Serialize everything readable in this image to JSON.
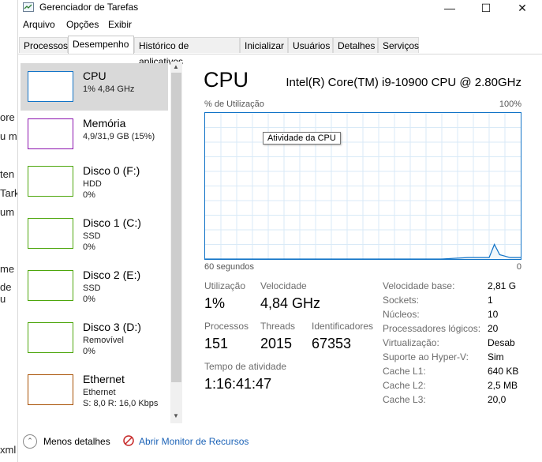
{
  "window": {
    "title": "Gerenciador de Tarefas",
    "minimize_icon": "minimize-icon",
    "maximize_icon": "maximize-icon",
    "close_icon": "close-icon"
  },
  "background_fragments": [
    "ore",
    "u m",
    "ten",
    "Tark",
    "um",
    "me",
    "de u",
    "xml"
  ],
  "menu": [
    "Arquivo",
    "Opções",
    "Exibir"
  ],
  "tabs": [
    "Processos",
    "Desempenho",
    "Histórico de aplicativos",
    "Inicializar",
    "Usuários",
    "Detalhes",
    "Serviços"
  ],
  "active_tab": "Desempenho",
  "resources": [
    {
      "name": "CPU",
      "sub1": "1% 4,84 GHz",
      "sub2": "",
      "color": "#1173c7",
      "selected": true
    },
    {
      "name": "Memória",
      "sub1": "4,9/31,9 GB (15%)",
      "sub2": "",
      "color": "#8b12ae",
      "selected": false
    },
    {
      "name": "Disco 0 (F:)",
      "sub1": "HDD",
      "sub2": "0%",
      "color": "#4da60c",
      "selected": false
    },
    {
      "name": "Disco 1 (C:)",
      "sub1": "SSD",
      "sub2": "0%",
      "color": "#4da60c",
      "selected": false
    },
    {
      "name": "Disco 2 (E:)",
      "sub1": "SSD",
      "sub2": "0%",
      "color": "#4da60c",
      "selected": false
    },
    {
      "name": "Disco 3 (D:)",
      "sub1": "Removível",
      "sub2": "0%",
      "color": "#4da60c",
      "selected": false
    },
    {
      "name": "Ethernet",
      "sub1": "Ethernet",
      "sub2": "S: 8,0  R: 16,0 Kbps",
      "color": "#a74f01",
      "selected": false
    }
  ],
  "main": {
    "title": "CPU",
    "model": "Intel(R) Core(TM) i9-10900 CPU @ 2.80GHz",
    "graph_label": "% de Utilização",
    "graph_max": "100%",
    "tooltip": "Atividade da CPU",
    "axis_left": "60 segundos",
    "axis_right": "0",
    "stats": {
      "utilizacao_label": "Utilização",
      "utilizacao": "1%",
      "velocidade_label": "Velocidade",
      "velocidade": "4,84 GHz",
      "processos_label": "Processos",
      "processos": "151",
      "threads_label": "Threads",
      "threads": "2015",
      "identificadores_label": "Identificadores",
      "identificadores": "67353",
      "tempo_label": "Tempo de atividade",
      "tempo": "1:16:41:47"
    },
    "info": [
      {
        "label": "Velocidade base:",
        "value": "2,81 G"
      },
      {
        "label": "Sockets:",
        "value": "1"
      },
      {
        "label": "Núcleos:",
        "value": "10"
      },
      {
        "label": "Processadores lógicos:",
        "value": "20"
      },
      {
        "label": "Virtualização:",
        "value": "Desab"
      },
      {
        "label": "Suporte ao Hyper-V:",
        "value": "Sim"
      },
      {
        "label": "Cache L1:",
        "value": "640 KB"
      },
      {
        "label": "Cache L2:",
        "value": "2,5 MB"
      },
      {
        "label": "Cache L3:",
        "value": "20,0"
      }
    ]
  },
  "footer": {
    "less_details": "Menos detalhes",
    "monitor_link": "Abrir Monitor de Recursos"
  },
  "chart_data": {
    "type": "area",
    "x": [
      60,
      55,
      50,
      45,
      40,
      35,
      30,
      25,
      20,
      15,
      10,
      6,
      5,
      4,
      3,
      2,
      1,
      0
    ],
    "values": [
      0,
      0,
      0,
      0,
      0,
      0,
      0,
      0,
      0,
      0,
      1,
      1,
      10,
      3,
      2,
      1,
      1,
      1
    ],
    "ylim": [
      0,
      100
    ],
    "grid": true
  }
}
